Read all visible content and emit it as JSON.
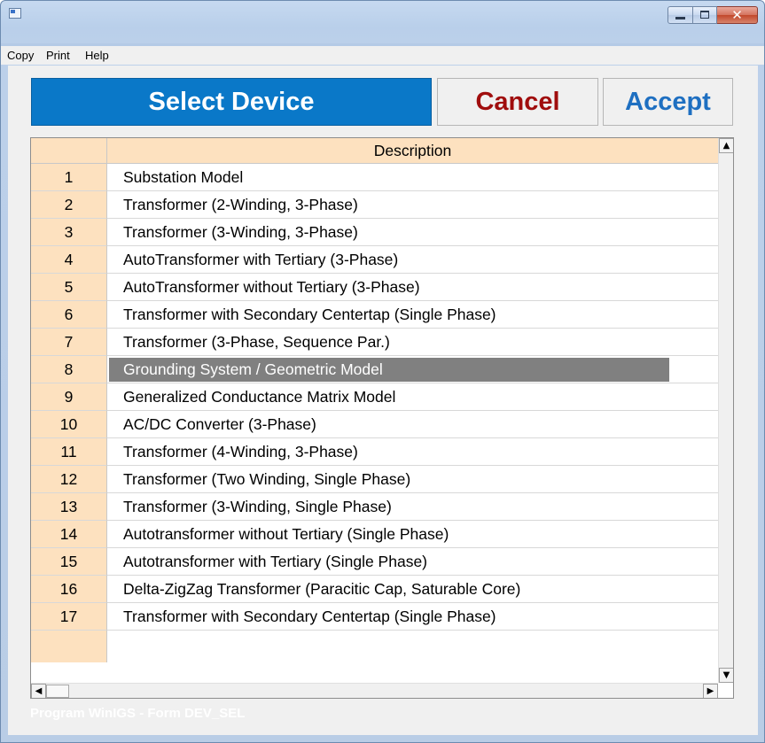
{
  "window": {
    "title": "",
    "icon": "app-window-icon"
  },
  "menu": [
    "Copy",
    "Print",
    "Help"
  ],
  "buttons": {
    "select": "Select Device",
    "cancel": "Cancel",
    "accept": "Accept"
  },
  "table": {
    "header": "Description",
    "rows": [
      {
        "num": "1",
        "desc": "Substation Model"
      },
      {
        "num": "2",
        "desc": "Transformer (2-Winding, 3-Phase)"
      },
      {
        "num": "3",
        "desc": "Transformer (3-Winding, 3-Phase)"
      },
      {
        "num": "4",
        "desc": "AutoTransformer with Tertiary (3-Phase)"
      },
      {
        "num": "5",
        "desc": "AutoTransformer without Tertiary (3-Phase)"
      },
      {
        "num": "6",
        "desc": "Transformer with Secondary Centertap (Single Phase)"
      },
      {
        "num": "7",
        "desc": "Transformer (3-Phase, Sequence Par.)"
      },
      {
        "num": "8",
        "desc": "Grounding System / Geometric Model"
      },
      {
        "num": "9",
        "desc": "Generalized Conductance Matrix Model"
      },
      {
        "num": "10",
        "desc": "AC/DC Converter (3-Phase)"
      },
      {
        "num": "11",
        "desc": "Transformer (4-Winding, 3-Phase)"
      },
      {
        "num": "12",
        "desc": "Transformer (Two Winding, Single Phase)"
      },
      {
        "num": "13",
        "desc": "Transformer (3-Winding, Single Phase)"
      },
      {
        "num": "14",
        "desc": "Autotransformer without Tertiary (Single Phase)"
      },
      {
        "num": "15",
        "desc": "Autotransformer with Tertiary (Single Phase)"
      },
      {
        "num": "16",
        "desc": "Delta-ZigZag Transformer (Paracitic Cap, Saturable Core)"
      },
      {
        "num": "17",
        "desc": "Transformer with Secondary Centertap (Single Phase)"
      }
    ],
    "selected_row": "8"
  },
  "status": "Program WinIGS - Form DEV_SEL",
  "colors": {
    "select_bg": "#0a78c8",
    "cancel_text": "#a00d0d",
    "accept_text": "#1e6fc1",
    "row_header_bg": "#fde1bf",
    "selection_bg": "#808080"
  }
}
